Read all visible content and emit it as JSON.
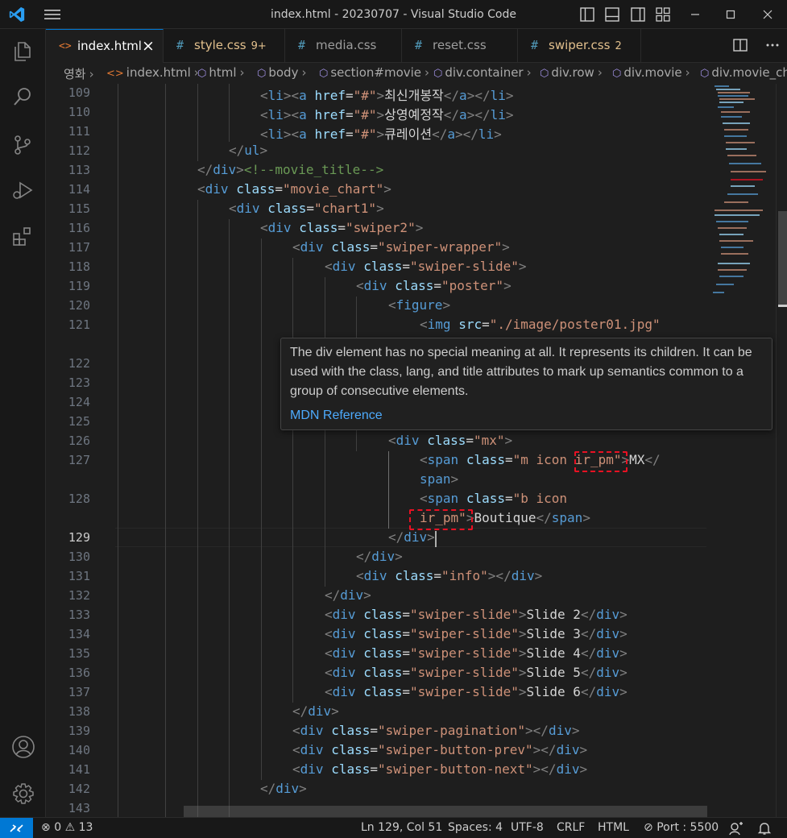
{
  "window": {
    "title": "index.html - 20230707 - Visual Studio Code"
  },
  "tabs": [
    {
      "icon": "<>",
      "label": "index.html",
      "badge": "",
      "active": true
    },
    {
      "icon": "#",
      "label": "style.css",
      "badge": "9+",
      "active": false
    },
    {
      "icon": "#",
      "label": "media.css",
      "badge": "",
      "active": false
    },
    {
      "icon": "#",
      "label": "reset.css",
      "badge": "",
      "active": false
    },
    {
      "icon": "#",
      "label": "swiper.css",
      "badge": "2",
      "active": false
    }
  ],
  "breadcrumb": [
    "영화",
    "index.html",
    "html",
    "body",
    "section#movie",
    "div.container",
    "div.row",
    "div.movie",
    "div.movie_ch"
  ],
  "line_numbers": [
    "109",
    "110",
    "111",
    "112",
    "113",
    "114",
    "115",
    "116",
    "117",
    "118",
    "119",
    "120",
    "121",
    "122",
    "123",
    "124",
    "125",
    "126",
    "127",
    "128",
    "129",
    "130",
    "131",
    "132",
    "133",
    "134",
    "135",
    "136",
    "137",
    "138",
    "139",
    "140",
    "141",
    "142",
    "143"
  ],
  "active_line": "129",
  "code": {
    "l109": [
      "<",
      "li",
      "><",
      "a",
      " ",
      "href",
      "=",
      "\"#\"",
      ">",
      "최신개봉작",
      "</",
      "a",
      "></",
      "li",
      ">"
    ],
    "l110": [
      "<",
      "li",
      "><",
      "a",
      " ",
      "href",
      "=",
      "\"#\"",
      ">",
      "상영예정작",
      "</",
      "a",
      "></",
      "li",
      ">"
    ],
    "l111": [
      "<",
      "li",
      "><",
      "a",
      " ",
      "href",
      "=",
      "\"#\"",
      ">",
      "큐레이션",
      "</",
      "a",
      "></",
      "li",
      ">"
    ],
    "l112": [
      "</",
      "ul",
      ">"
    ],
    "l113": [
      "</",
      "div",
      ">",
      "<!--movie_title-->"
    ],
    "l114": [
      "<",
      "div",
      " ",
      "class",
      "=",
      "\"movie_chart\"",
      ">"
    ],
    "l115": [
      "<",
      "div",
      " ",
      "class",
      "=",
      "\"chart1\"",
      ">"
    ],
    "l116": [
      "<",
      "div",
      " ",
      "class",
      "=",
      "\"swiper2\"",
      ">"
    ],
    "l117": [
      "<",
      "div",
      " ",
      "class",
      "=",
      "\"swiper-wrapper\"",
      ">"
    ],
    "l118": [
      "<",
      "div",
      " ",
      "class",
      "=",
      "\"swiper-slide\"",
      ">"
    ],
    "l119": [
      "<",
      "div",
      " ",
      "class",
      "=",
      "\"poster\"",
      ">"
    ],
    "l120": [
      "<",
      "figure",
      ">"
    ],
    "l121": [
      "<",
      "img",
      " ",
      "src",
      "=",
      "\"./image/poster01.jpg\""
    ],
    "l126": [
      "<",
      "div",
      " ",
      "class",
      "=",
      "\"mx\"",
      ">"
    ],
    "l127a": [
      "<",
      "span",
      " ",
      "class",
      "=",
      "\"m icon ",
      "ir_pm",
      "\"",
      ">",
      "MX",
      "</"
    ],
    "l127b": [
      "span",
      ">"
    ],
    "l128a": [
      "<",
      "span",
      " ",
      "class",
      "=",
      "\"b icon"
    ],
    "l128b": [
      "ir_pm",
      "\"",
      ">",
      "Boutique",
      "</",
      "span",
      ">"
    ],
    "l129": [
      "</",
      "div",
      ">"
    ],
    "l130": [
      "</",
      "div",
      ">"
    ],
    "l131": [
      "<",
      "div",
      " ",
      "class",
      "=",
      "\"info\"",
      "></",
      "div",
      ">"
    ],
    "l132": [
      "</",
      "div",
      ">"
    ],
    "l133": [
      "<",
      "div",
      " ",
      "class",
      "=",
      "\"swiper-slide\"",
      ">",
      "Slide 2",
      "</",
      "div",
      ">"
    ],
    "l134": [
      "<",
      "div",
      " ",
      "class",
      "=",
      "\"swiper-slide\"",
      ">",
      "Slide 3",
      "</",
      "div",
      ">"
    ],
    "l135": [
      "<",
      "div",
      " ",
      "class",
      "=",
      "\"swiper-slide\"",
      ">",
      "Slide 4",
      "</",
      "div",
      ">"
    ],
    "l136": [
      "<",
      "div",
      " ",
      "class",
      "=",
      "\"swiper-slide\"",
      ">",
      "Slide 5",
      "</",
      "div",
      ">"
    ],
    "l137": [
      "<",
      "div",
      " ",
      "class",
      "=",
      "\"swiper-slide\"",
      ">",
      "Slide 6",
      "</",
      "div",
      ">"
    ],
    "l138": [
      "</",
      "div",
      ">"
    ],
    "l139": [
      "<",
      "div",
      " ",
      "class",
      "=",
      "\"swiper-pagination\"",
      "></",
      "div",
      ">"
    ],
    "l140": [
      "<",
      "div",
      " ",
      "class",
      "=",
      "\"swiper-button-prev\"",
      "></",
      "div",
      ">"
    ],
    "l141": [
      "<",
      "div",
      " ",
      "class",
      "=",
      "\"swiper-button-next\"",
      "></",
      "div",
      ">"
    ],
    "l142": [
      "</",
      "div",
      ">"
    ]
  },
  "hover": {
    "text": "The div element has no special meaning at all. It represents its children. It can be used with the class, lang, and title attributes to mark up semantics common to a group of consecutive elements.",
    "link": "MDN Reference"
  },
  "status": {
    "errors": "0",
    "warnings": "13",
    "position": "Ln 129, Col 51",
    "spaces": "Spaces: 4",
    "encoding": "UTF-8",
    "eol": "CRLF",
    "language": "HTML",
    "port": "Port : 5500"
  },
  "colors": {
    "accent": "#0078d4",
    "tag": "#569cd6",
    "attr": "#9cdcfe",
    "string": "#ce9178",
    "comment": "#6a9955",
    "warning_tab": "#e2c08d",
    "highlight_box": "#e81123"
  }
}
